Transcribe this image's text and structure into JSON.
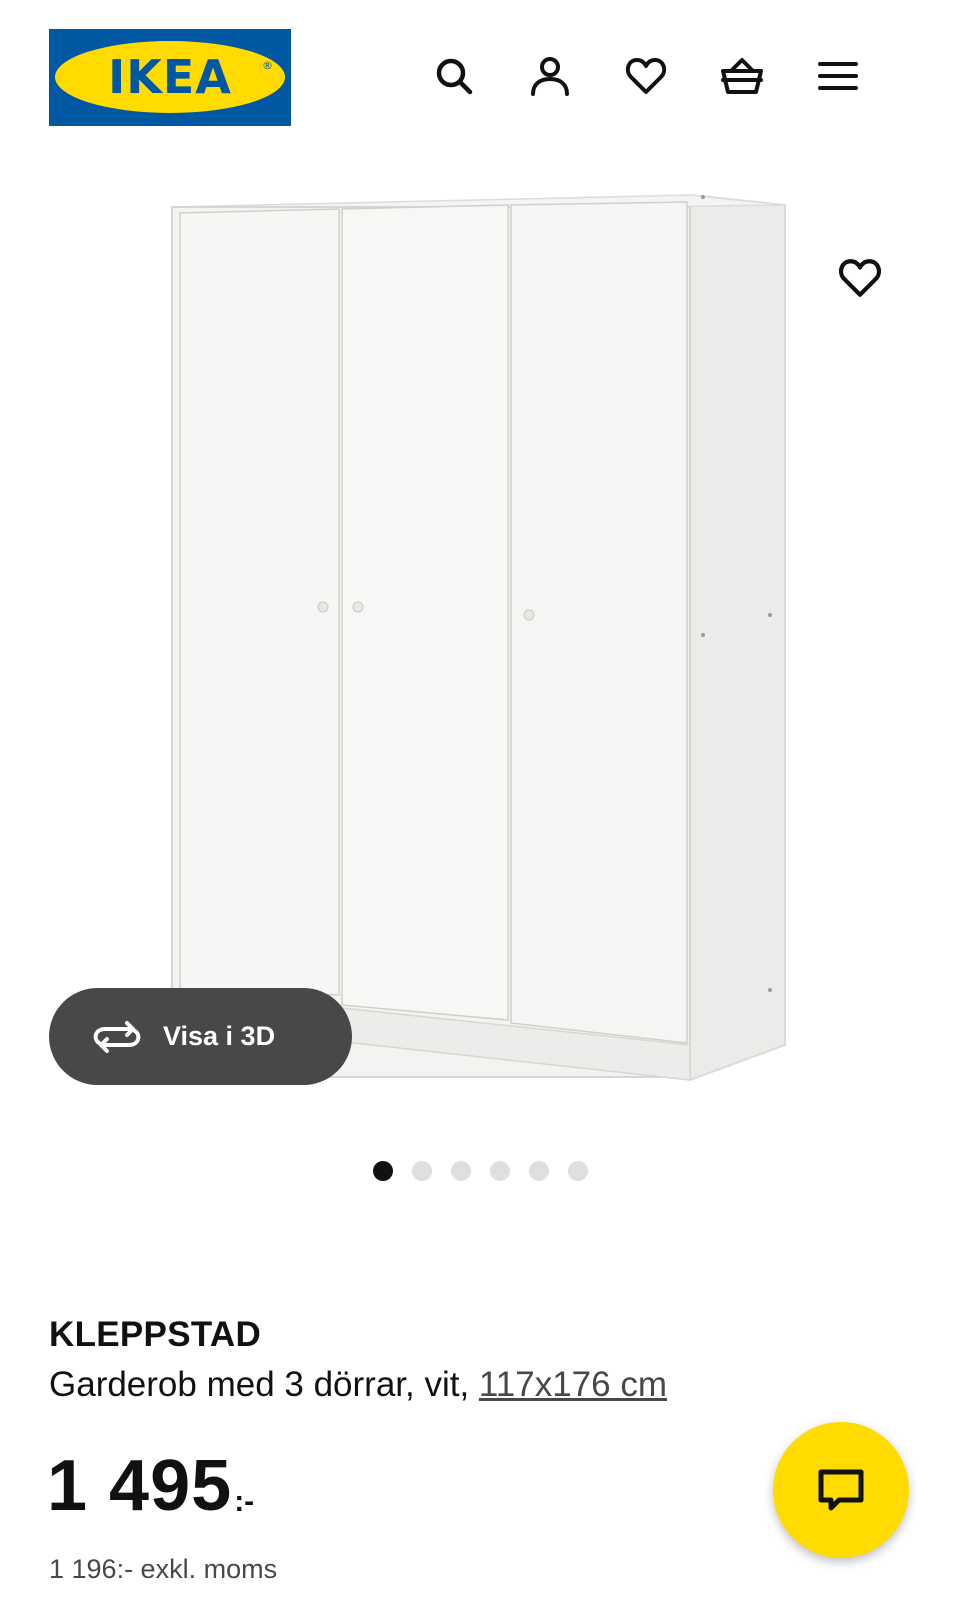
{
  "header": {
    "logo_text": "IKEA",
    "logo_reg": "®",
    "icons": [
      "search-icon",
      "profile-icon",
      "heart-icon",
      "basket-icon",
      "menu-icon"
    ]
  },
  "gallery": {
    "view_3d_label": "Visa i 3D",
    "image_count": 6,
    "active_index": 0
  },
  "product": {
    "name": "KLEPPSTAD",
    "description": "Garderob med 3 dörrar, vit, ",
    "size_link": "117x176 cm",
    "price_integer": "1 495",
    "price_suffix": ":-",
    "price_excl_vat": "1 196:- exkl. moms"
  },
  "colors": {
    "brand_blue": "#0058a3",
    "brand_yellow": "#ffdb00",
    "text": "#111111",
    "secondary_text": "#484848"
  }
}
